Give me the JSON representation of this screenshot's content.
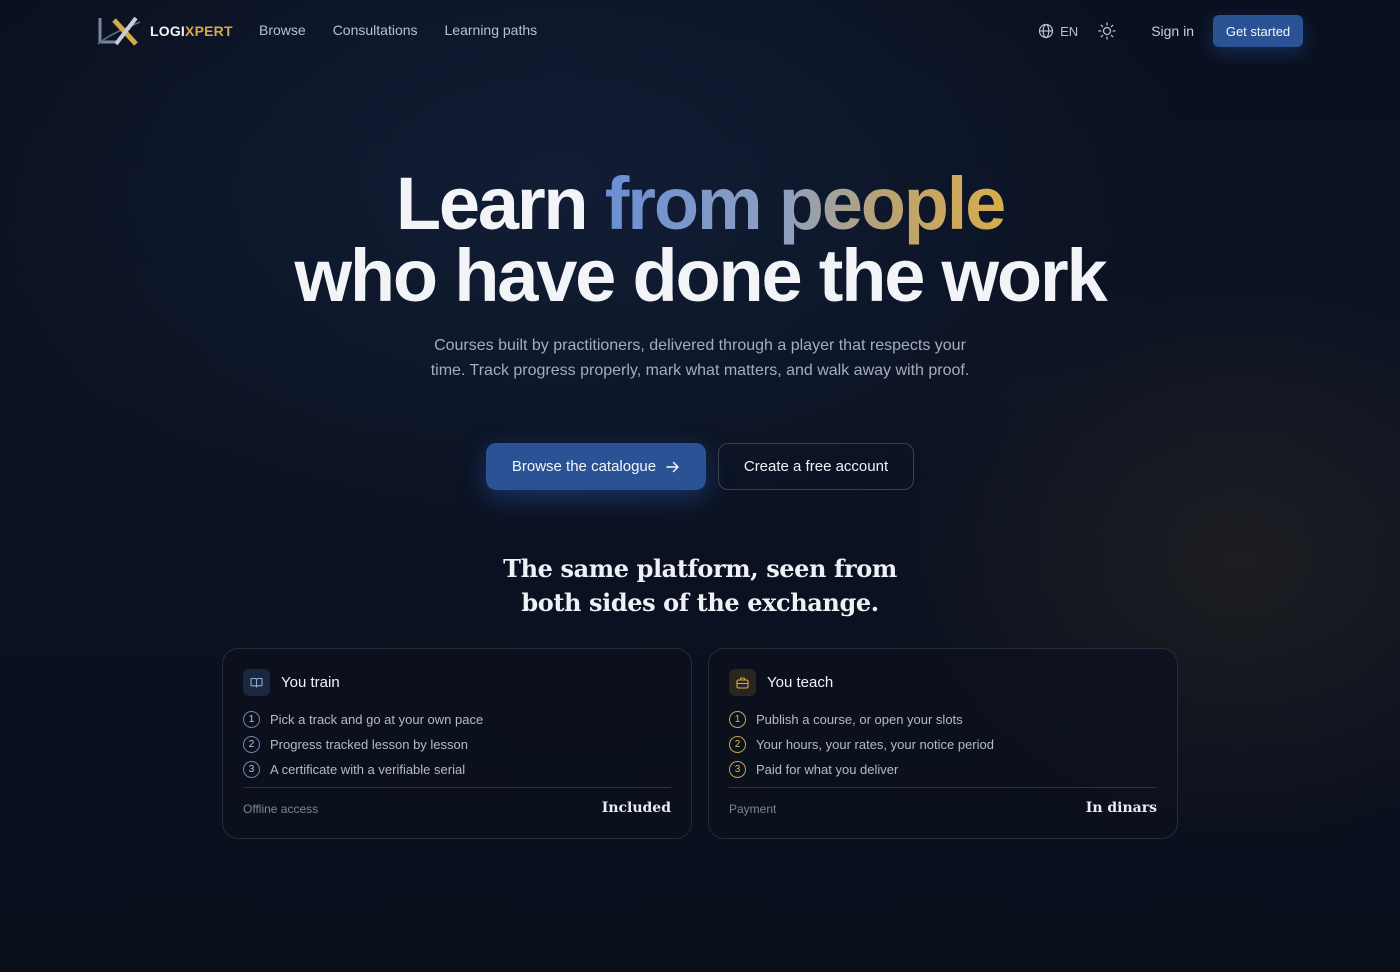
{
  "nav": {
    "brand": {
      "part1": "LOGI",
      "part2": "XPERT"
    },
    "links": [
      "Browse",
      "Consultations",
      "Learning paths"
    ],
    "language": "EN",
    "sign_in": "Sign in",
    "get_started": "Get started"
  },
  "hero": {
    "title_word1": "Learn",
    "title_highlight": "from people",
    "title_line2": "who have done the work",
    "subtitle": "Courses built by practitioners, delivered through a player that respects your time. Track progress properly, mark what matters, and walk away with proof.",
    "primary_cta": "Browse the catalogue",
    "secondary_cta": "Create a free account"
  },
  "section": {
    "title_line1": "The same platform, seen from",
    "title_line2": "both sides of the exchange."
  },
  "cards": [
    {
      "title": "You train",
      "icon": "book-icon",
      "steps": [
        {
          "num": "1",
          "text": "Pick a track and go at your own pace"
        },
        {
          "num": "2",
          "text": "Progress tracked lesson by lesson"
        },
        {
          "num": "3",
          "text": "A certificate with a verifiable serial"
        }
      ],
      "footer_label": "Offline access",
      "footer_value": "Included"
    },
    {
      "title": "You teach",
      "icon": "briefcase-icon",
      "steps": [
        {
          "num": "1",
          "text": "Publish a course, or open your slots"
        },
        {
          "num": "2",
          "text": "Your hours, your rates, your notice period"
        },
        {
          "num": "3",
          "text": "Paid for what you deliver"
        }
      ],
      "footer_label": "Payment",
      "footer_value": "In dinars"
    }
  ],
  "colors": {
    "accent_blue": "#2c5296",
    "accent_gold": "#d4a94a",
    "background": "#0a1020"
  }
}
